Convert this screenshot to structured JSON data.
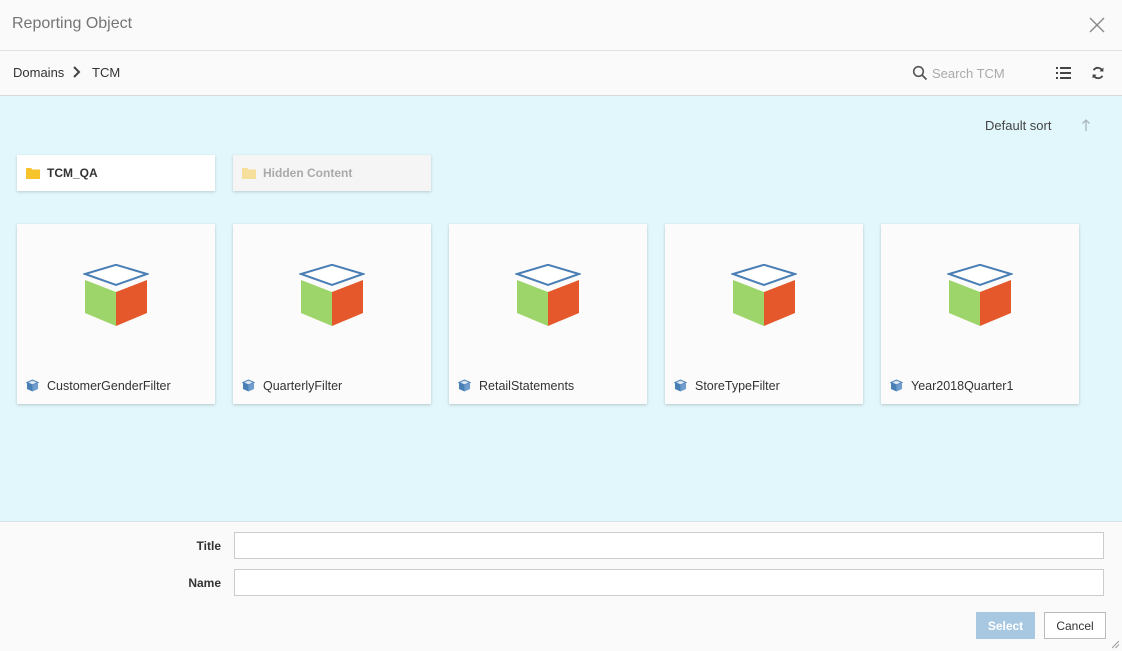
{
  "dialog": {
    "title": "Reporting Object"
  },
  "toolbar": {
    "breadcrumb": [
      "Domains",
      "TCM"
    ],
    "search_placeholder": "Search TCM",
    "search_value": ""
  },
  "content": {
    "sort_label": "Default sort",
    "folders": [
      {
        "name": "TCM_QA",
        "hidden": false
      },
      {
        "name": "Hidden Content",
        "hidden": true
      }
    ],
    "objects": [
      {
        "name": "CustomerGenderFilter"
      },
      {
        "name": "QuarterlyFilter"
      },
      {
        "name": "RetailStatements"
      },
      {
        "name": "StoreTypeFilter"
      },
      {
        "name": "Year2018Quarter1"
      }
    ]
  },
  "form": {
    "title_label": "Title",
    "title_value": "",
    "name_label": "Name",
    "name_value": ""
  },
  "buttons": {
    "select": "Select",
    "cancel": "Cancel"
  },
  "colors": {
    "content_bg": "#e1f7fc",
    "folder_icon": "#f7c52b",
    "cube_green": "#9ed56b",
    "cube_red": "#e4582b",
    "cube_outline": "#4a7fb5",
    "select_button": "#a8c8e2"
  }
}
